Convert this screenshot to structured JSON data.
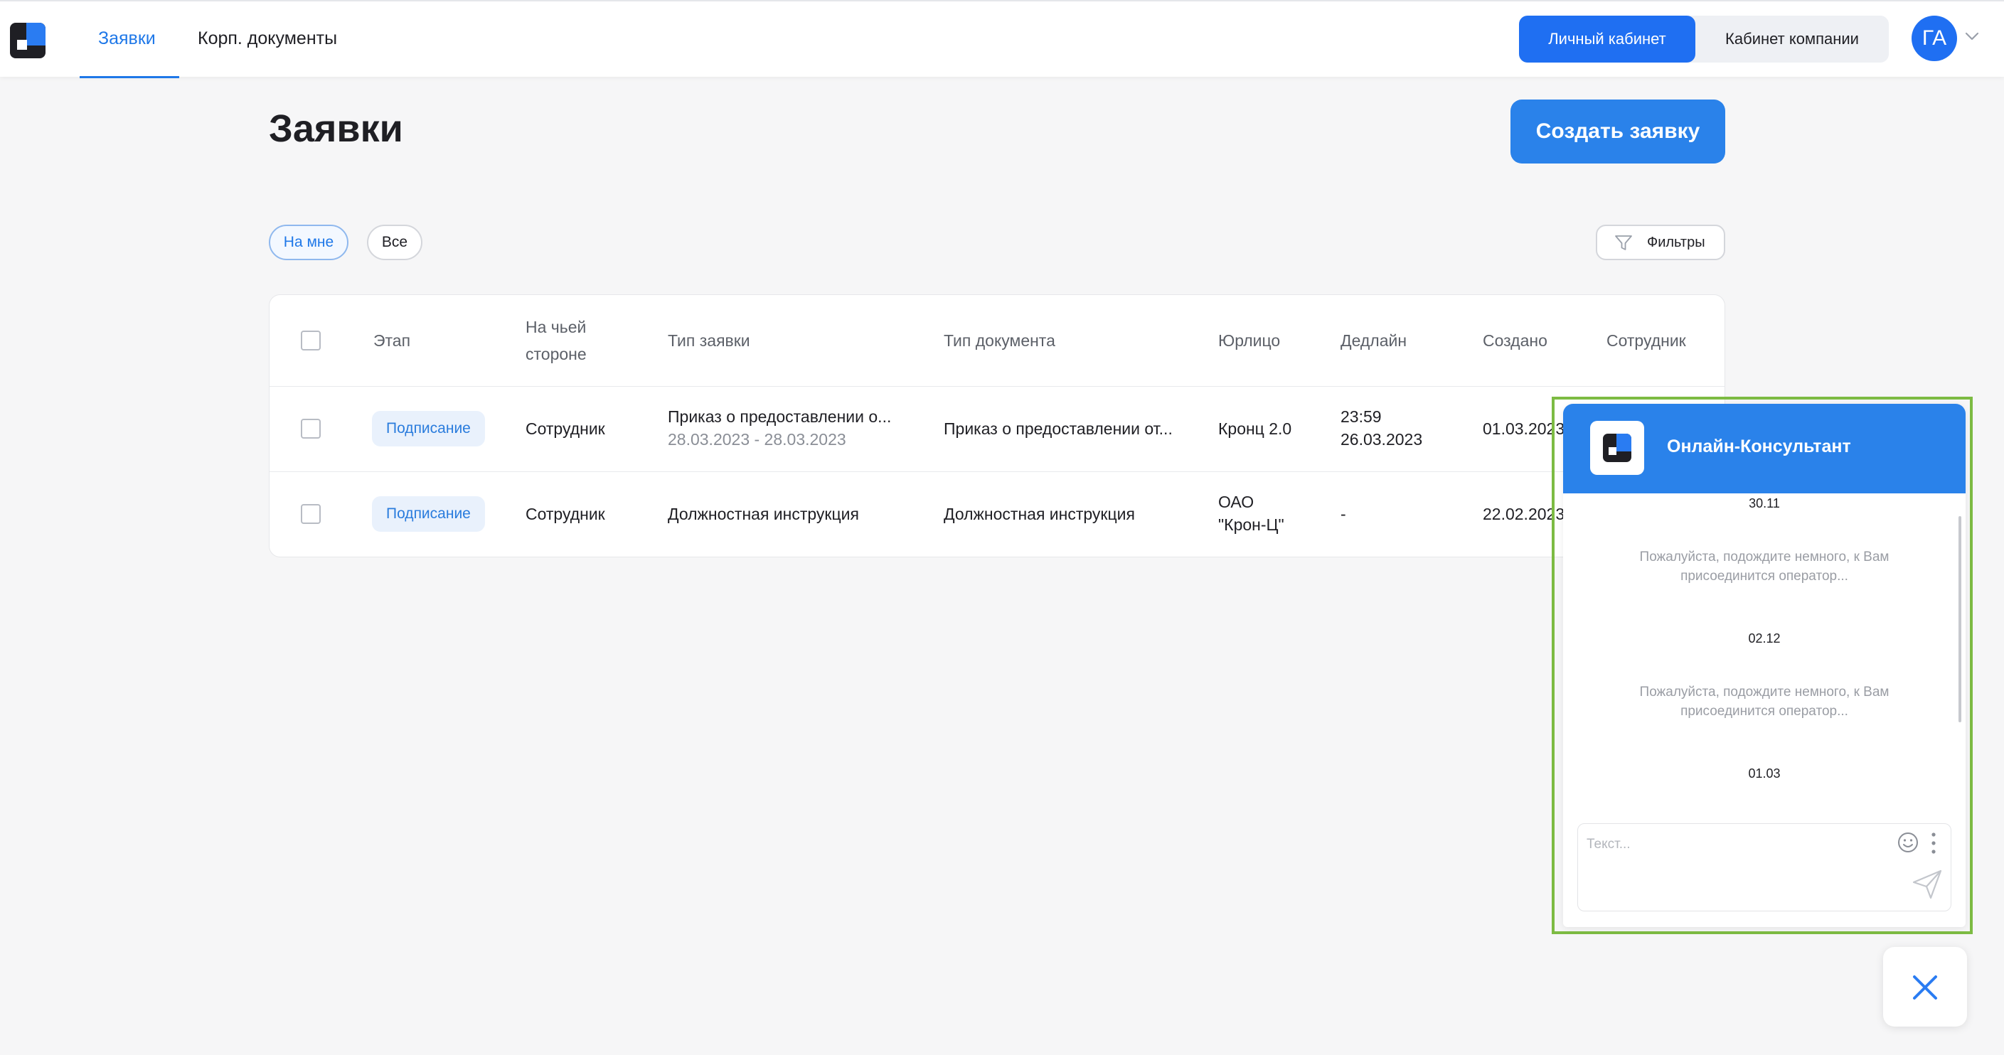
{
  "nav": {
    "tabs": [
      {
        "label": "Заявки",
        "active": true
      },
      {
        "label": "Корп. документы",
        "active": false
      }
    ]
  },
  "cabinet": {
    "personal": "Личный кабинет",
    "company": "Кабинет компании"
  },
  "user": {
    "initials": "ГА"
  },
  "page": {
    "title": "Заявки",
    "create_button": "Создать заявку"
  },
  "filters": {
    "chips": [
      "На мне",
      "Все"
    ],
    "filters_button": "Фильтры"
  },
  "table": {
    "columns": {
      "stage": "Этап",
      "side_line1": "На чьей",
      "side_line2": "стороне",
      "request_type": "Тип заявки",
      "doc_type": "Тип документа",
      "entity": "Юрлицо",
      "deadline": "Дедлайн",
      "created": "Создано",
      "employee": "Сотрудник"
    },
    "rows": [
      {
        "stage": "Подписание",
        "side": "Сотрудник",
        "request_type": "Приказ о предоставлении о...",
        "request_dates": "28.03.2023 - 28.03.2023",
        "doc_type": "Приказ о предоставлении от...",
        "entity_line1": "Кронц 2.0",
        "entity_line2": "",
        "deadline_line1": "23:59",
        "deadline_line2": "26.03.2023",
        "created": "01.03.2023"
      },
      {
        "stage": "Подписание",
        "side": "Сотрудник",
        "request_type": "Должностная инструкция",
        "request_dates": "",
        "doc_type": "Должностная инструкция",
        "entity_line1": "ОАО",
        "entity_line2": "\"Крон-Ц\"",
        "deadline_line1": "-",
        "deadline_line2": "",
        "created": "22.02.2023"
      }
    ]
  },
  "chat": {
    "title": "Онлайн-Консультант",
    "messages": [
      {
        "date": "30.11",
        "text": "Пожалуйста, подождите немного, к Вам присоединится оператор..."
      },
      {
        "date": "02.12",
        "text": "Пожалуйста, подождите немного, к Вам присоединится оператор..."
      },
      {
        "date": "01.03",
        "text": ""
      }
    ],
    "input_placeholder": "Текст...",
    "input_value": ""
  },
  "colors": {
    "accent": "#1f78e8",
    "primary_button": "#2a82ea",
    "badge_bg": "#e9f1fc",
    "highlight_frame": "#7dbb43"
  }
}
